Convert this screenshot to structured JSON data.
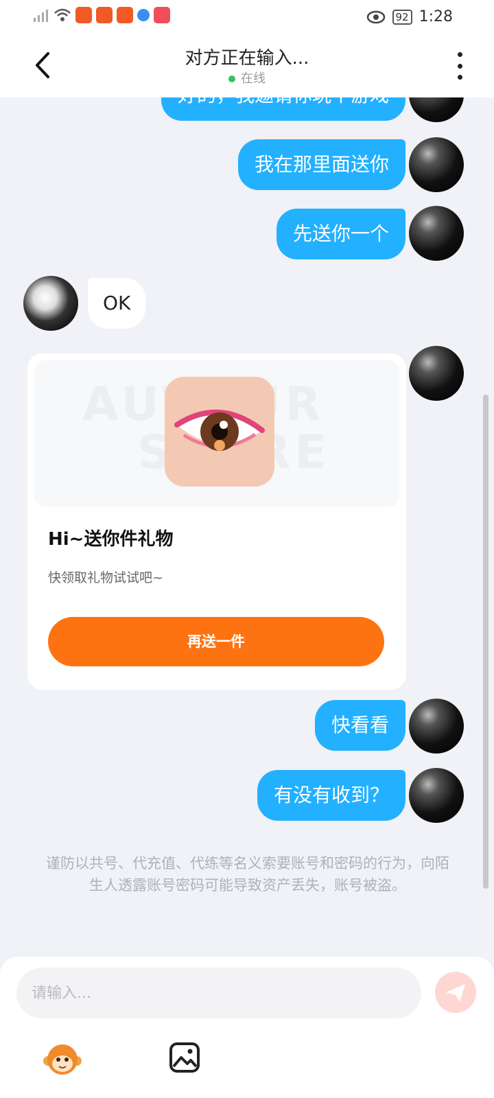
{
  "status_bar": {
    "battery": "92",
    "time": "1:28"
  },
  "header": {
    "title": "对方正在输入...",
    "online_status": "在线"
  },
  "messages": [
    {
      "side": "out",
      "text": "好的，我邀请你玩个游戏"
    },
    {
      "side": "out",
      "text": "我在那里面送你"
    },
    {
      "side": "out",
      "text": "先送你一个"
    },
    {
      "side": "in",
      "text": "OK"
    },
    {
      "side": "out",
      "text": "快看看"
    },
    {
      "side": "out",
      "text": "有没有收到？"
    }
  ],
  "gift_card": {
    "watermark_line1": "AUTOUR",
    "watermark_line2": "STORE",
    "title": "Hi~送你件礼物",
    "subtitle": "快领取礼物试试吧~",
    "button_label": "再送一件"
  },
  "warning_text": "谨防以共号、代充值、代练等名义索要账号和密码的行为，向陌生人透露账号密码可能导致资产丢失，账号被盗。",
  "input": {
    "placeholder": "请输入..."
  },
  "colors": {
    "outgoing_bubble": "#23b0ff",
    "gift_button": "#fd7311",
    "online_dot": "#32c35e"
  }
}
